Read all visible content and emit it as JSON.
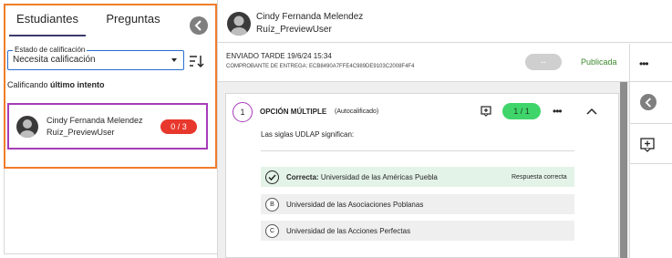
{
  "tabs": {
    "students": "Estudiantes",
    "questions": "Preguntas"
  },
  "filter": {
    "label": "Estado de calificación",
    "value": "Necesita calificación"
  },
  "grading": {
    "prefix": "Calificando",
    "emphasis": "último intento"
  },
  "student": {
    "first_line": "Cindy Fernanda Melendez",
    "second_line": "Ruíz_PreviewUser",
    "score": "0 / 3"
  },
  "header": {
    "name_line1": "Cindy Fernanda Melendez",
    "name_line2": "Ruíz_PreviewUser"
  },
  "submission": {
    "status": "ENVIADO TARDE 19/6/24 15:34",
    "receipt": "COMPROBANTE DE ENTREGA: ECB8490A7FFE4C989DE9103C2008F4F4",
    "grade": "--",
    "published": "Publicada",
    "more": "•••"
  },
  "question": {
    "number": "1",
    "type": "OPCIÓN MÚLTIPLE",
    "auto": "(Autocalificado)",
    "score": "1 / 1",
    "more": "•••",
    "prompt": "Las siglas UDLAP significan:",
    "options": [
      {
        "label": "Correcta:",
        "text": "Universidad de las Américas Puebla",
        "note": "Respuesta correcta"
      },
      {
        "letter": "B",
        "text": "Universidad de las Asociaciones Poblanas"
      },
      {
        "letter": "C",
        "text": "Universidad de las Acciones Perfectas"
      }
    ]
  },
  "colors": {
    "accent_orange": "#f07c2a",
    "accent_purple": "#a63cb8",
    "badge_red": "#e8372c",
    "score_green": "#3fd56a",
    "published_green": "#3d8a2e"
  }
}
